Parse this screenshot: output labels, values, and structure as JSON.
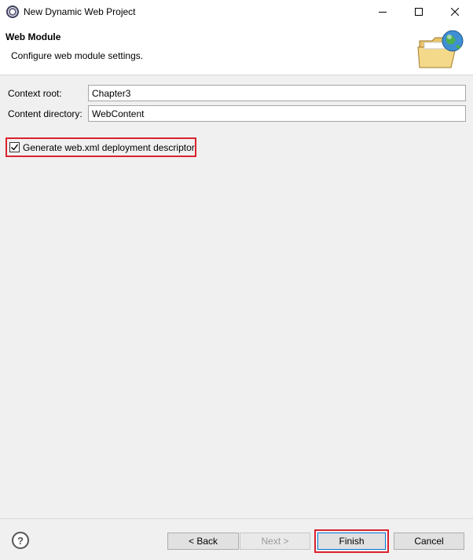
{
  "window": {
    "title": "New Dynamic Web Project"
  },
  "banner": {
    "title": "Web Module",
    "message": "Configure web module settings."
  },
  "form": {
    "context_root_label": "Context root:",
    "context_root_value": "Chapter3",
    "content_dir_label": "Content directory:",
    "content_dir_value": "WebContent",
    "generate_xml_label": "Generate web.xml deployment descriptor",
    "generate_xml_checked": true
  },
  "buttons": {
    "help_symbol": "?",
    "back": "< Back",
    "next": "Next >",
    "finish": "Finish",
    "cancel": "Cancel"
  },
  "icons": {
    "app": "eclipse-icon",
    "banner": "web-folder-globe-icon",
    "minimize": "minimize-icon",
    "maximize": "maximize-icon",
    "close": "close-icon",
    "check": "checkmark-icon",
    "help": "help-icon"
  },
  "colors": {
    "highlight": "#d9232e",
    "focus": "#0078d7"
  }
}
